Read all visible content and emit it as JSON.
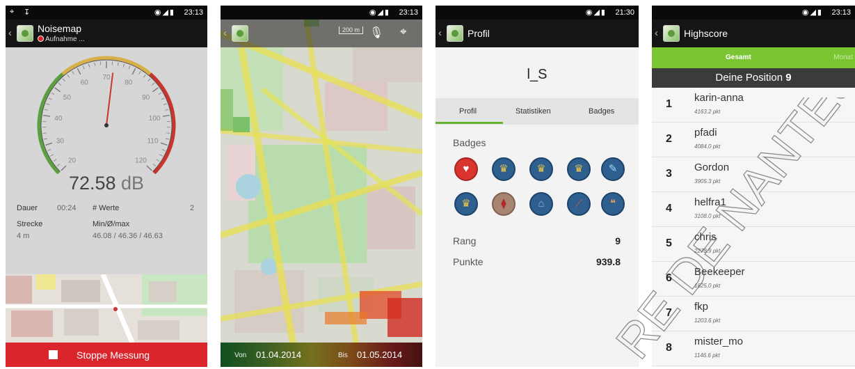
{
  "colors": {
    "accent_green": "#7ac531",
    "record_red": "#d9252b",
    "badge_blue": "#2e5f8f"
  },
  "screen1": {
    "status_time": "23:13",
    "app_title": "Noisemap",
    "recording_label": "Aufnahme ...",
    "gauge_ticks": [
      "20",
      "30",
      "40",
      "50",
      "60",
      "70",
      "80",
      "90",
      "100",
      "110",
      "120"
    ],
    "needle_db": 72.58,
    "db_value": "72.58",
    "db_unit": "dB",
    "duration_label": "Dauer",
    "duration_value": "00:24",
    "values_label": "# Werte",
    "values_count": "2",
    "distance_label": "Strecke",
    "distance_value": "4 m",
    "minmax_label": "Min/Ø/max",
    "minmax_value": "46.08 / 46.36 / 46.63",
    "stop_label": "Stoppe Messung"
  },
  "screen2": {
    "status_time": "23:13",
    "scale_label": "200 m",
    "from_label": "Von",
    "from_date": "01.04.2014",
    "to_label": "Bis",
    "to_date": "01.05.2014"
  },
  "screen3": {
    "status_time": "21:30",
    "title": "Profil",
    "username": "l_S",
    "tabs": [
      "Profil",
      "Statistiken",
      "Badges"
    ],
    "badges_heading": "Badges",
    "badge_icons": [
      "heart-badge-icon",
      "trophy-badge-icon",
      "trophy-badge-icon",
      "trophy-badge-icon",
      "chat-badge-icon",
      "trophy-badge-icon",
      "tie-badge-icon",
      "museum-badge-icon",
      "compass-badge-icon",
      "speech-badge-icon"
    ],
    "rank_label": "Rang",
    "rank_value": "9",
    "points_label": "Punkte",
    "points_value": "939.8"
  },
  "screen4": {
    "status_time": "23:13",
    "title": "Highscore",
    "tab_total": "Gesamt",
    "tab_month": "Monat",
    "position_label": "Deine Position",
    "position_value": "9",
    "rows": [
      {
        "rank": "1",
        "name": "karin-anna",
        "points": "4163.2 pkt"
      },
      {
        "rank": "2",
        "name": "pfadi",
        "points": "4084.0 pkt"
      },
      {
        "rank": "3",
        "name": "Gordon",
        "points": "3905.3 pkt"
      },
      {
        "rank": "4",
        "name": "helfra1",
        "points": "3108.0 pkt"
      },
      {
        "rank": "5",
        "name": "chris",
        "points": "2278.9 pkt"
      },
      {
        "rank": "6",
        "name": "Beekeeper",
        "points": "1625.0 pkt"
      },
      {
        "rank": "7",
        "name": "fkp",
        "points": "1203.6 pkt"
      },
      {
        "rank": "8",
        "name": "mister_mo",
        "points": "1146.6 pkt"
      }
    ]
  }
}
